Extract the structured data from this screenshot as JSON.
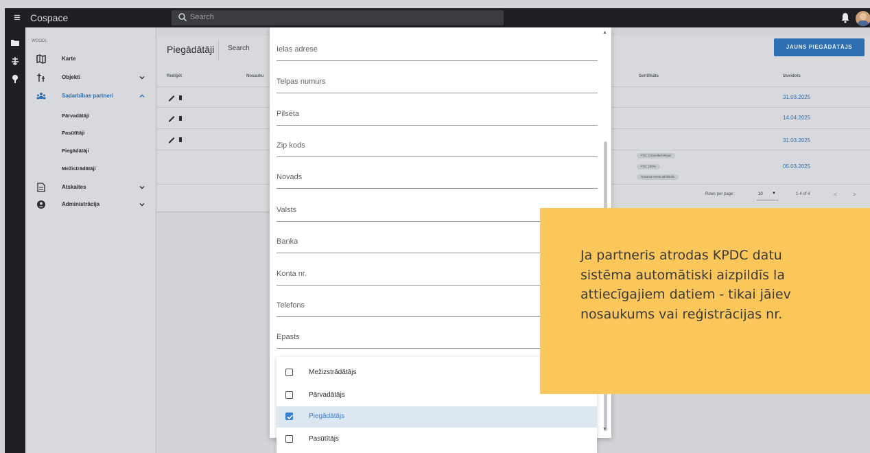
{
  "app": {
    "title": "Cospace",
    "search_placeholder": "Search"
  },
  "sidebar": {
    "org": "WOODL",
    "items": [
      {
        "label": "Karte"
      },
      {
        "label": "Objekti"
      },
      {
        "label": "Sadarbības partneri"
      },
      {
        "label": "Atskaites"
      },
      {
        "label": "Administrācija"
      }
    ],
    "subitems": [
      "Pārvadātāji",
      "Pasūtītāji",
      "Piegādātāji",
      "Mežistrādātāji"
    ]
  },
  "page": {
    "title": "Piegādātāji",
    "search_label": "Search",
    "new_button": "JAUNS PIEGĀDĀTĀJS",
    "columns": {
      "edit": "Rediģēt",
      "name": "Nosauku",
      "certs": "Sertifikāts",
      "created": "Izveidots"
    },
    "rows": [
      {
        "created": "31.03.2025"
      },
      {
        "created": "14.04.2025"
      },
      {
        "created": "31.03.2025"
      },
      {
        "created": "05.03.2025",
        "certs": [
          "FSC Controlled Wood",
          "FSC 100%",
          "Graanul Invest atbilstošs"
        ]
      }
    ],
    "pagination": {
      "rows_per_page_label": "Rows per page:",
      "rows_per_page": "10",
      "range": "1-4 of 4"
    }
  },
  "dialog": {
    "fields": [
      "Ielas adrese",
      "Telpas numurs",
      "Pilsēta",
      "Zip kods",
      "Novads",
      "Valsts",
      "Banka",
      "Konta nr.",
      "Telefons",
      "Epasts"
    ],
    "options": [
      {
        "label": "Mežizstrādātājs",
        "checked": false
      },
      {
        "label": "Pārvadātājs",
        "checked": false
      },
      {
        "label": "Piegādātājs",
        "checked": true
      },
      {
        "label": "Pasūtītājs",
        "checked": false
      }
    ]
  },
  "callout": {
    "lines": [
      "Ja partneris atrodas KPDC datu",
      "sistēma automātiski aizpildīs la",
      "attiecīgajiem datiem - tikai jāiev",
      "nosaukums vai reģistrācijas nr."
    ]
  },
  "colors": {
    "accent": "#2d6fb3",
    "callout": "#fbc65a",
    "appbar": "#1f2023"
  }
}
